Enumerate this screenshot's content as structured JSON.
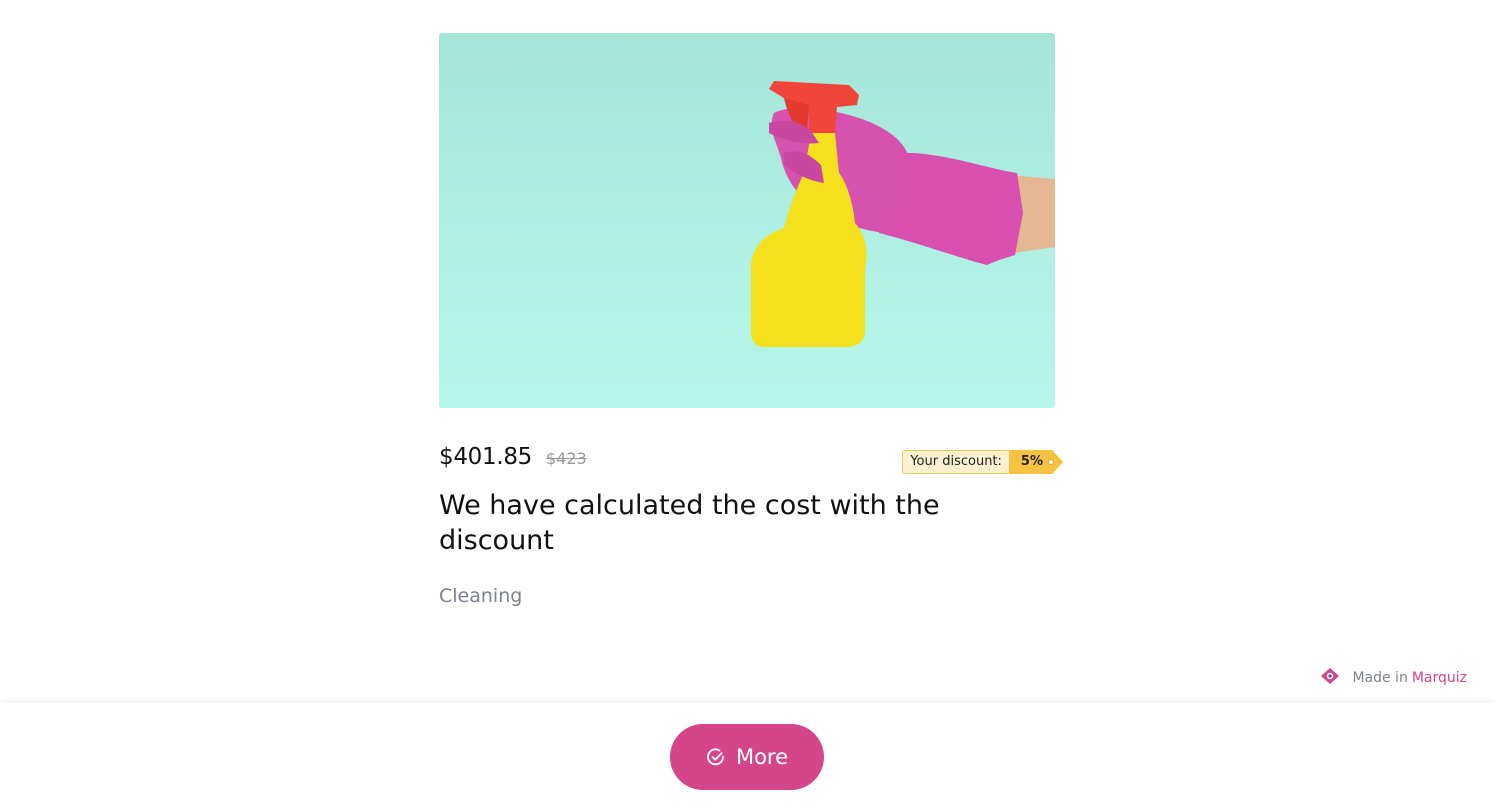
{
  "product": {
    "image_alt": "cleaning-spray-in-pink-glove",
    "price": "$401.85",
    "old_price": "$423",
    "discount_label": "Your discount:",
    "discount_value": "5%",
    "title": "We have calculated the cost with the discount",
    "category": "Cleaning"
  },
  "branding": {
    "made_in_prefix": "Made in",
    "brand_name": "Marquiz"
  },
  "footer": {
    "more_label": "More",
    "more_icon": "check-circle-icon"
  },
  "colors": {
    "accent": "#d4458a",
    "discount_tag": "#f5c341",
    "image_bg": "#a6e6d9"
  }
}
